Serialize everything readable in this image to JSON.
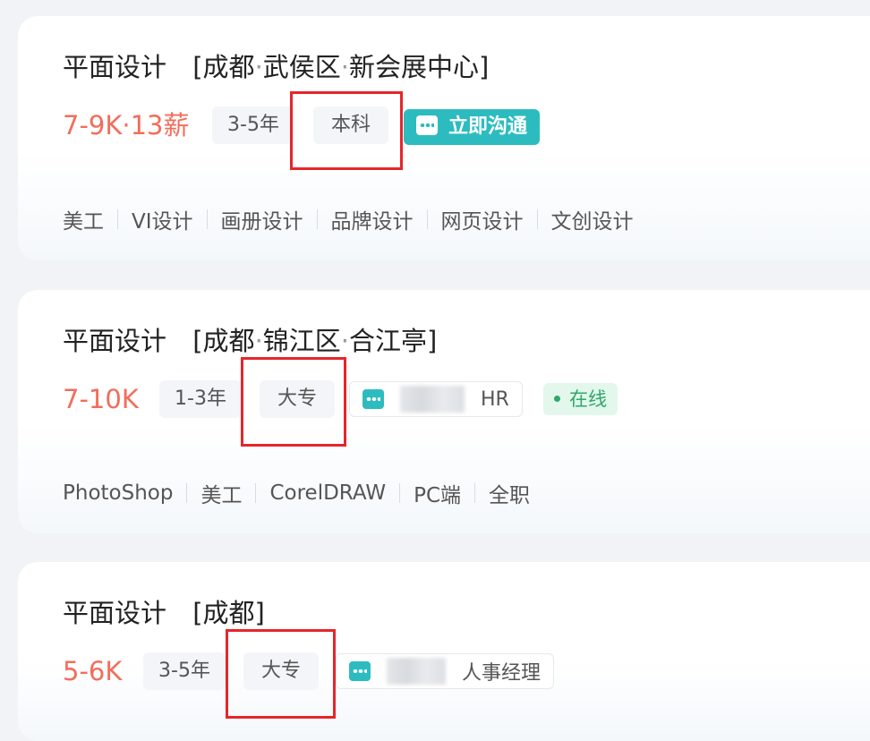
{
  "jobs": [
    {
      "title": "平面设计",
      "location": [
        "[成都",
        "武侯区",
        "新会展中心]"
      ],
      "salary": "7-9K·13薪",
      "experience": "3-5年",
      "education": "本科",
      "chat_button": "立即沟通",
      "skills": [
        "美工",
        "VI设计",
        "画册设计",
        "品牌设计",
        "网页设计",
        "文创设计"
      ]
    },
    {
      "title": "平面设计",
      "location": [
        "[成都",
        "锦江区",
        "合江亭]"
      ],
      "salary": "7-10K",
      "experience": "1-3年",
      "education": "大专",
      "recruiter_title": "HR",
      "online_status": "在线",
      "skills": [
        "PhotoShop",
        "美工",
        "CorelDRAW",
        "PC端",
        "全职"
      ]
    },
    {
      "title": "平面设计",
      "location": [
        "[成都]"
      ],
      "salary": "5-6K",
      "experience": "3-5年",
      "education": "大专",
      "recruiter_title": "人事经理"
    }
  ],
  "colors": {
    "salary": "#f26d5b",
    "chat_button": "#2cbcc0",
    "online": "#2ea86b",
    "highlight_box": "#e5262b"
  }
}
